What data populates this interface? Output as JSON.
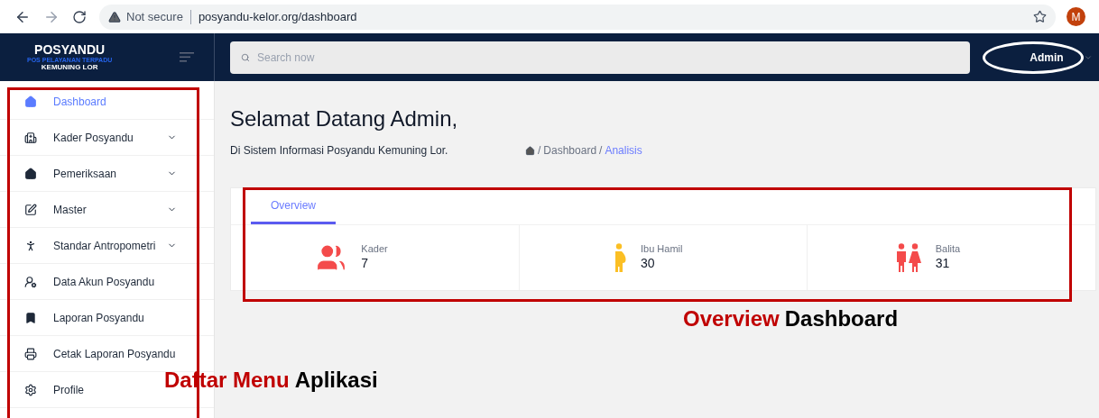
{
  "browser": {
    "security": "Not secure",
    "url": "posyandu-kelor.org/dashboard",
    "profile_initial": "M"
  },
  "logo": {
    "title": "POSYANDU",
    "subtitle": "POS PELAYANAN TERPADU",
    "place": "KEMUNING LOR"
  },
  "search": {
    "placeholder": "Search now"
  },
  "user": {
    "name": "Admin"
  },
  "sidebar": {
    "items": [
      {
        "label": "Dashboard",
        "selected": true,
        "expandable": false
      },
      {
        "label": "Kader Posyandu",
        "selected": false,
        "expandable": true
      },
      {
        "label": "Pemeriksaan",
        "selected": false,
        "expandable": true
      },
      {
        "label": "Master",
        "selected": false,
        "expandable": true
      },
      {
        "label": "Standar Antropometri",
        "selected": false,
        "expandable": true
      },
      {
        "label": "Data Akun Posyandu",
        "selected": false,
        "expandable": false
      },
      {
        "label": "Laporan Posyandu",
        "selected": false,
        "expandable": false
      },
      {
        "label": "Cetak Laporan Posyandu",
        "selected": false,
        "expandable": false
      },
      {
        "label": "Profile",
        "selected": false,
        "expandable": false
      }
    ]
  },
  "page": {
    "title": "Selamat Datang Admin,",
    "subtitle": "Di Sistem Informasi Posyandu Kemuning Lor.",
    "breadcrumb_separator": "/",
    "breadcrumb": [
      {
        "label": "Dashboard",
        "selected": false
      },
      {
        "label": "Analisis",
        "selected": true
      }
    ]
  },
  "tabs": [
    {
      "label": "Overview",
      "selected": true
    }
  ],
  "stats": [
    {
      "label": "Kader",
      "value": "7"
    },
    {
      "label": "Ibu Hamil",
      "value": "30"
    },
    {
      "label": "Balita",
      "value": "31"
    }
  ],
  "annotations": [
    {
      "highlight": "Overview",
      "text": "Dashboard"
    },
    {
      "highlight": "Daftar Menu",
      "text": "Aplikasi"
    }
  ]
}
